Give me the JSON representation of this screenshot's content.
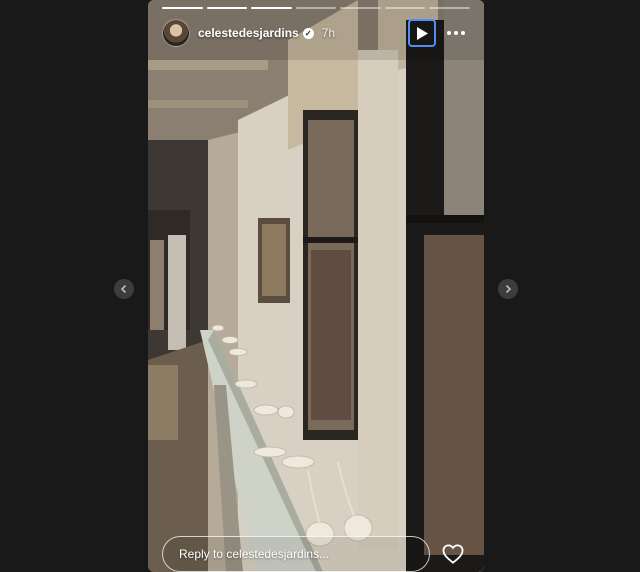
{
  "story": {
    "segments_total": 7,
    "segments_done": 3,
    "username": "celestedesjardins",
    "time_ago": "7h",
    "reply_placeholder": "Reply to celestedesjardins..."
  },
  "icons": {
    "verified": "verified-badge-icon",
    "play": "play-icon",
    "more": "more-options-icon",
    "like": "heart-icon",
    "prev": "chevron-left-icon",
    "next": "chevron-right-icon"
  },
  "colors": {
    "page_background": "#191919",
    "focus_outline": "#4f8ff7",
    "nav_button": "#3c3c3c"
  }
}
